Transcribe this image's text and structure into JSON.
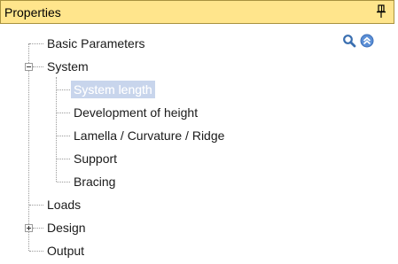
{
  "header": {
    "title": "Properties",
    "pin_icon": "pin-icon"
  },
  "toolbar": {
    "search_icon": "search-icon",
    "collapse_icon": "collapse-up-icon"
  },
  "colors": {
    "header_bg": "#ffe58c",
    "selection_bg": "#c8d5ec",
    "tree_lines": "#9a9a9a",
    "search_icon": "#3a6fb0",
    "collapse_icon": "#5b8fd6"
  },
  "tree": {
    "basic_parameters": "Basic Parameters",
    "system": "System",
    "system_length": "System length",
    "development_of_height": "Development of height",
    "lamella": "Lamella / Curvature / Ridge",
    "support": "Support",
    "bracing": "Bracing",
    "loads": "Loads",
    "design": "Design",
    "output": "Output"
  }
}
